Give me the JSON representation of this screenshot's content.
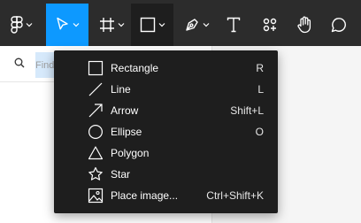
{
  "toolbar": {
    "tools": [
      {
        "name": "main-menu",
        "icon": "figma-logo-icon",
        "has_caret": true,
        "state": "normal"
      },
      {
        "name": "move",
        "icon": "move-cursor-icon",
        "has_caret": true,
        "state": "active"
      },
      {
        "name": "frame",
        "icon": "frame-hash-icon",
        "has_caret": true,
        "state": "normal"
      },
      {
        "name": "shape",
        "icon": "rectangle-icon",
        "has_caret": true,
        "state": "open"
      },
      {
        "name": "pen",
        "icon": "pen-nib-icon",
        "has_caret": true,
        "state": "normal"
      },
      {
        "name": "text",
        "icon": "text-t-icon",
        "has_caret": false,
        "state": "normal"
      },
      {
        "name": "resources",
        "icon": "components-grid-icon",
        "has_caret": false,
        "state": "normal"
      },
      {
        "name": "hand",
        "icon": "hand-icon",
        "has_caret": false,
        "state": "normal"
      },
      {
        "name": "comment",
        "icon": "comment-bubble-icon",
        "has_caret": false,
        "state": "normal"
      }
    ]
  },
  "left_panel": {
    "search": {
      "placeholder": "Find"
    }
  },
  "shape_menu": {
    "items": [
      {
        "label": "Rectangle",
        "shortcut": "R",
        "icon": "rectangle-icon"
      },
      {
        "label": "Line",
        "shortcut": "L",
        "icon": "line-icon"
      },
      {
        "label": "Arrow",
        "shortcut": "Shift+L",
        "icon": "arrow-icon"
      },
      {
        "label": "Ellipse",
        "shortcut": "O",
        "icon": "ellipse-icon"
      },
      {
        "label": "Polygon",
        "shortcut": "",
        "icon": "polygon-icon"
      },
      {
        "label": "Star",
        "shortcut": "",
        "icon": "star-icon"
      },
      {
        "label": "Place image...",
        "shortcut": "Ctrl+Shift+K",
        "icon": "image-icon"
      }
    ]
  },
  "colors": {
    "toolbar_bg": "#2c2c2c",
    "active_tool": "#0d99ff",
    "open_tool": "#1e1e1e",
    "menu_bg": "#1e1e1e",
    "search_highlight": "#d6e9fb"
  }
}
